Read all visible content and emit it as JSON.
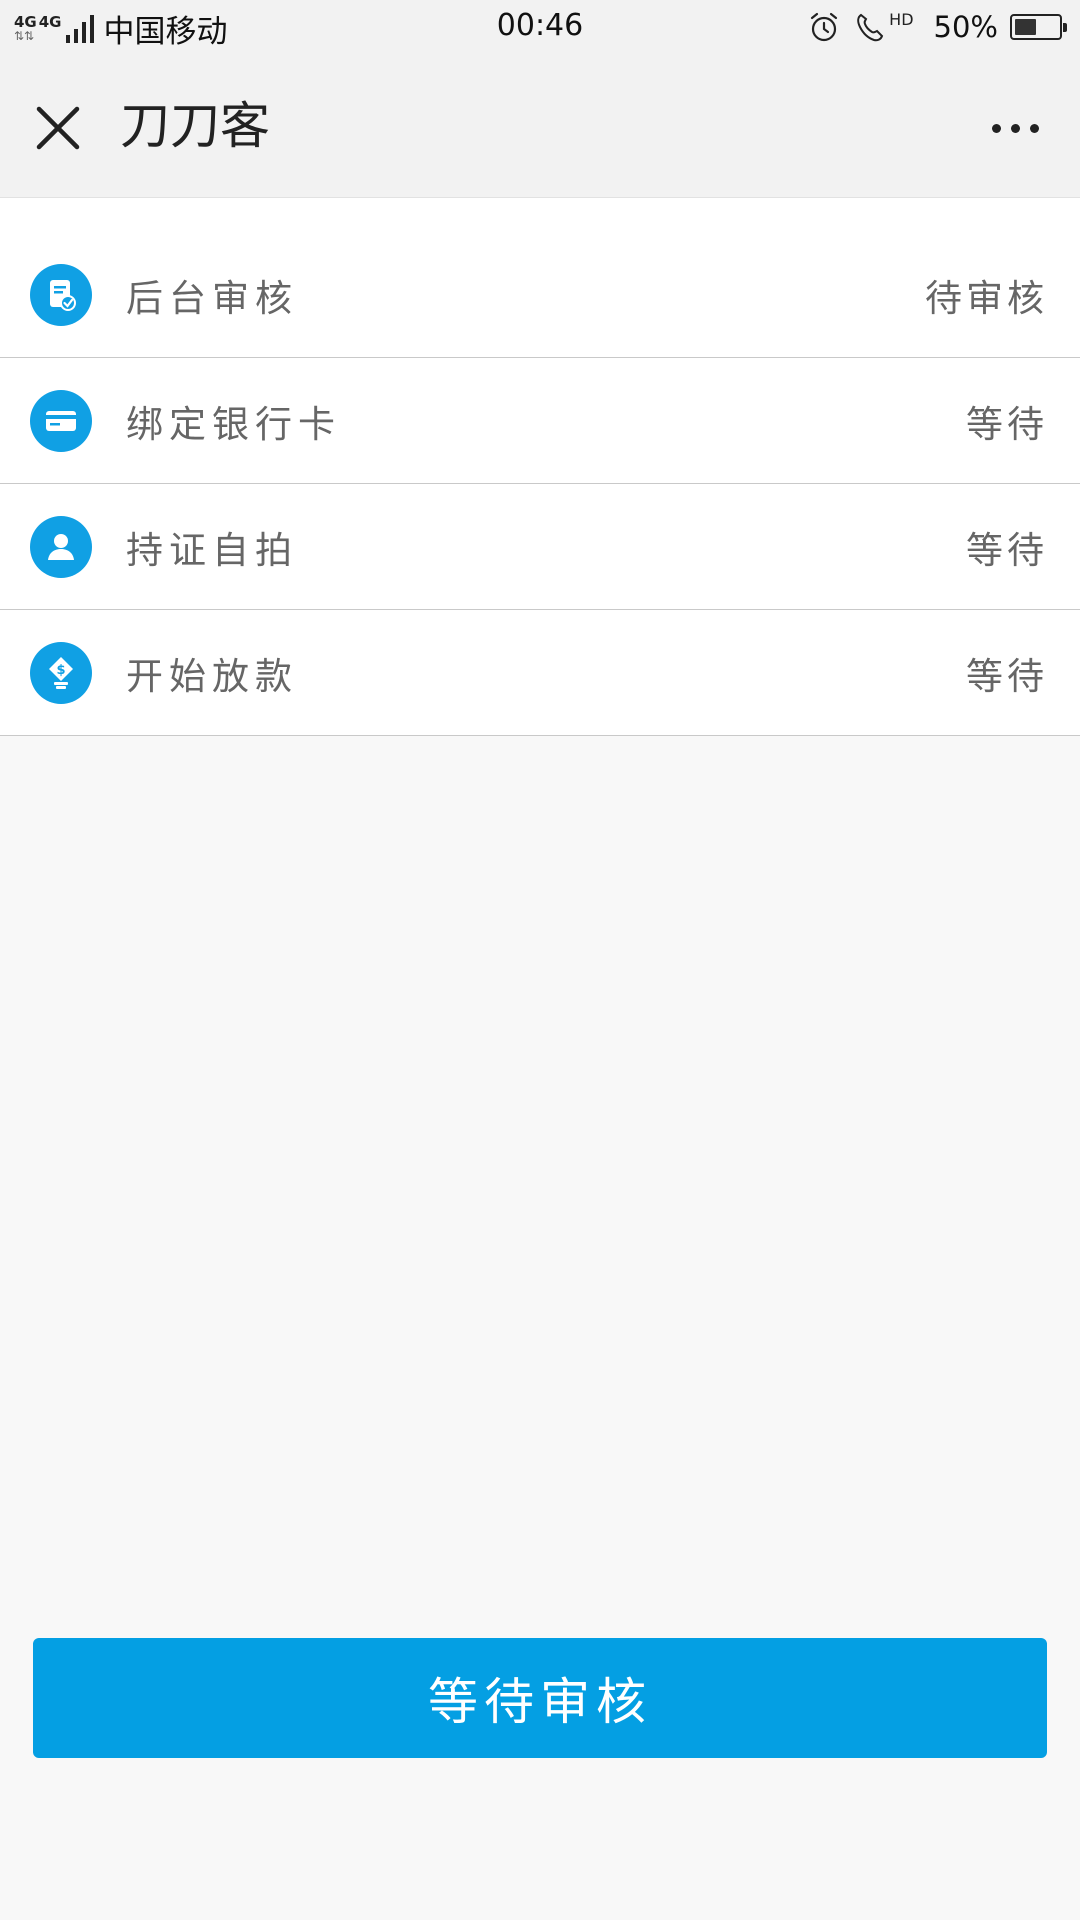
{
  "status_bar": {
    "network_type_1": "4G",
    "network_type_2": "4G",
    "carrier": "中国移动",
    "time": "00:46",
    "call_label": "HD",
    "battery_percent": "50%",
    "battery_level": 0.5
  },
  "nav": {
    "title": "刀刀客",
    "close_icon": "close-icon",
    "more_icon": "more-icon"
  },
  "steps": [
    {
      "label": "后台审核",
      "status": "待审核",
      "icon": "review-document-icon"
    },
    {
      "label": "绑定银行卡",
      "status": "等待",
      "icon": "bank-card-icon"
    },
    {
      "label": "持证自拍",
      "status": "等待",
      "icon": "user-icon"
    },
    {
      "label": "开始放款",
      "status": "等待",
      "icon": "money-hand-icon"
    }
  ],
  "main_button": {
    "label": "等待审核"
  },
  "colors": {
    "accent": "#049fe3",
    "icon_bg": "#10a0e4",
    "page_bg": "#f8f8f8"
  }
}
